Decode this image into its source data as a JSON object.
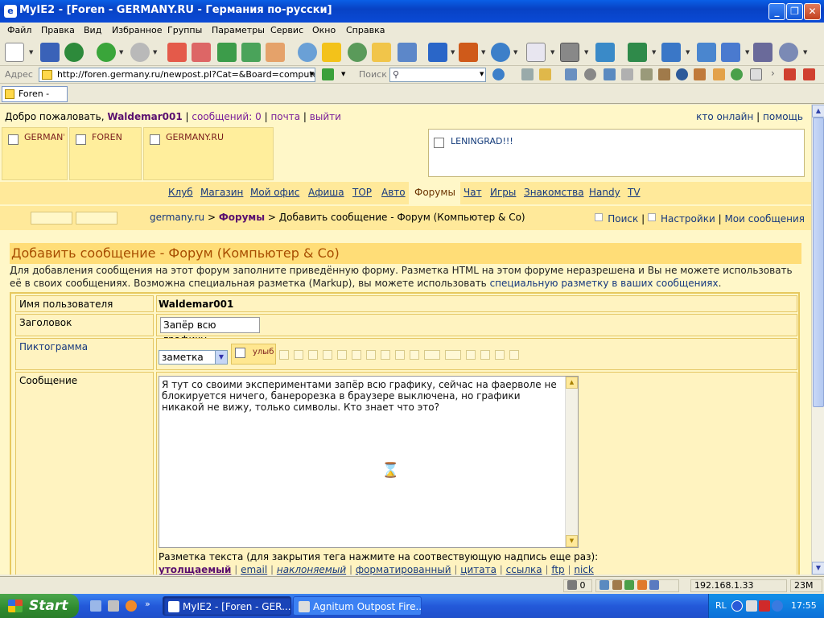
{
  "window": {
    "title": "MyIE2 - [Foren - GERMANY.RU - Германия по-русски]",
    "min": "_",
    "max": "❐",
    "close": "✕"
  },
  "menu": [
    "Файл",
    "Правка",
    "Вид",
    "Избранное",
    "Группы",
    "Параметры",
    "Сервис",
    "Окно",
    "Справка"
  ],
  "address": {
    "label": "Адрес",
    "url": "http://foren.germany.ru/newpost.pl?Cat=&Board=computer&",
    "search_label": "Поиск"
  },
  "tab": {
    "label": "Foren - GE..."
  },
  "site": {
    "welcome": "Добро пожаловать,",
    "username": "Waldemar001",
    "messages": "сообщений: 0",
    "mail": "почта",
    "logout": "выйти",
    "sep": "|",
    "who_online": "кто онлайн",
    "help": "помощь",
    "banners": [
      "GERMAN'",
      "FOREN",
      "GERMANY.RU"
    ],
    "ad": "LENINGRAD!!!",
    "nav": [
      "Клуб",
      "Магазин",
      "Мой офис",
      "Афиша",
      "TOP",
      "Авто",
      "Форумы",
      "Чат",
      "Игры",
      "Знакомства",
      "Handy",
      "TV"
    ],
    "crumb": {
      "site": "germany.ru",
      "arrow1": ">",
      "forums": "Форумы",
      "arrow2": ">",
      "current": "Добавить сообщение - Форум (Компьютер & Co)"
    },
    "right": {
      "search": "Поиск",
      "settings": "Настройки",
      "my_msgs": "Мои сообщения"
    }
  },
  "form": {
    "title": "Добавить сообщение - Форум (Компьютер & Co)",
    "intro_text": "Для добавления сообщения на этот форум заполните приведённую форму. Разметка HTML на этом форуме неразрешена и Вы не можете использовать её в своих сообщениях. Возможна специальная разметка (Markup), вы можете использовать ",
    "intro_link": "специальную разметку в ваших сообщениях",
    "intro_end": ".",
    "username_label": "Имя пользователя",
    "username_value": "Waldemar001",
    "subject_label": "Заголовок",
    "subject_value": "Запёр всю графику.",
    "icon_label": "Пиктограмма",
    "icon_select": "заметка",
    "icon_smile": "улыб",
    "message_label": "Сообщение",
    "message_value": "Я тут со своими экспериментами запёр всю графику, сейчас на фаерволе не блокируется ничего, банерорезка в браузере выключена, но графики никакой не вижу, только символы. Кто знает что это?",
    "markup_label": "Разметка текста (для закрытия тега нажмите на соотвествующую надпись еще раз):",
    "markup": {
      "bold": "утолщаемый",
      "email": "email",
      "italic": "наклоняемый",
      "formatted": "форматированный",
      "quote": "цитата",
      "link": "ссылка",
      "ftp": "ftp",
      "nick": "nick"
    }
  },
  "status": {
    "count": "0",
    "ip": "192.168.1.33",
    "mem": "23M"
  },
  "taskbar": {
    "start": "Start",
    "task1": "MyIE2 - [Foren - GER...",
    "task2": "Agnitum Outpost Fire...",
    "lang": "RL",
    "time": "17:55"
  }
}
